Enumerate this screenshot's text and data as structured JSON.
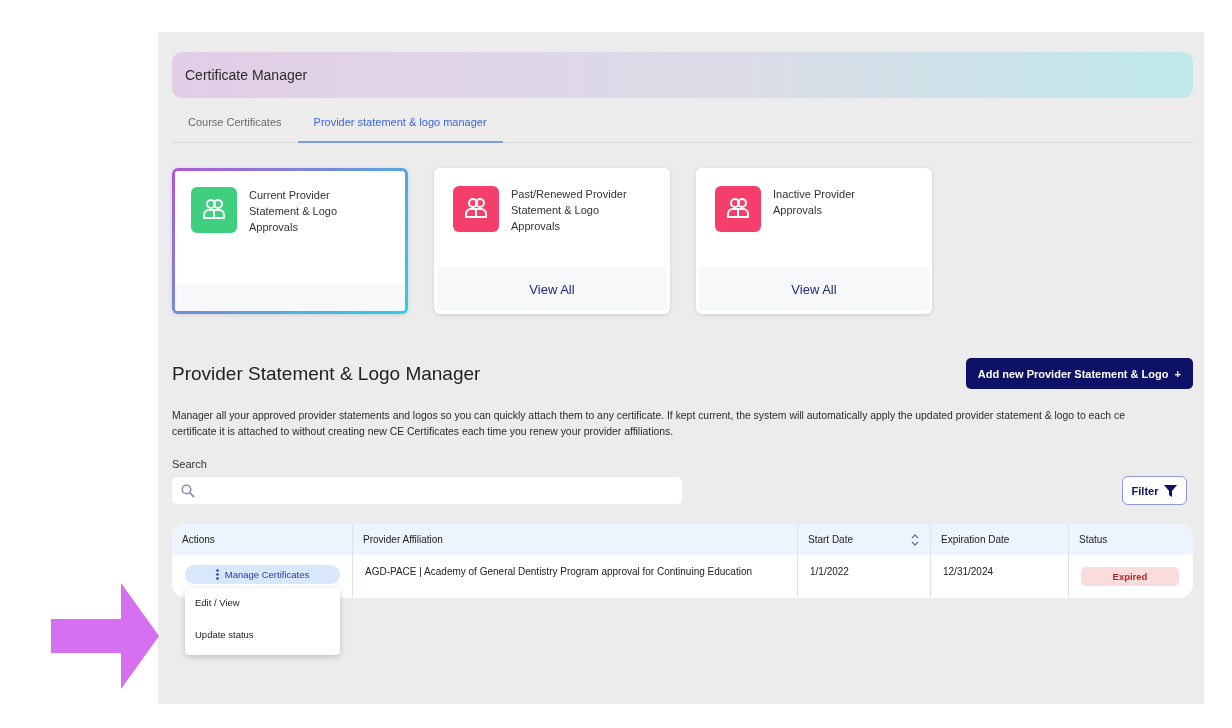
{
  "header": {
    "title": "Certificate Manager"
  },
  "tabs": [
    {
      "label": "Course Certificates",
      "selected": false
    },
    {
      "label": "Provider statement & logo manager",
      "selected": true
    }
  ],
  "cards": [
    {
      "title": "Current Provider Statement & Logo Approvals",
      "selected": true,
      "color": "#3ecf7f"
    },
    {
      "title": "Past/Renewed Provider Statement & Logo Approvals",
      "selected": false,
      "color": "#f43f6a",
      "link": "View All"
    },
    {
      "title": "Inactive Provider Approvals",
      "selected": false,
      "color": "#f43f6a",
      "link": "View All"
    }
  ],
  "section": {
    "title": "Provider Statement & Logo Manager",
    "add_button": "Add new Provider Statement & Logo",
    "add_icon": "+",
    "description": [
      "Manager all your approved provider statements and logos so you can quickly attach them to any certificate. If kept current, the system will automatically apply the updated provider statement & logo to each ce",
      "certificate it is attached to without creating new CE Certificates each time you renew your provider affiliations."
    ]
  },
  "search": {
    "label": "Search"
  },
  "filter_button": "Filter",
  "table": {
    "columns": [
      {
        "label": "Actions",
        "sortable": false
      },
      {
        "label": "Provider Affiliation",
        "sortable": false
      },
      {
        "label": "Start Date",
        "sortable": true
      },
      {
        "label": "Expiration Date",
        "sortable": false
      },
      {
        "label": "Status",
        "sortable": false
      }
    ],
    "rows": [
      {
        "action": "Manage Certificates",
        "provider": "AGD-PACE | Academy of General Dentistry Program approval for Continuing Education",
        "start": "1/1/2022",
        "expiration": "12/31/2024",
        "status": "Expired",
        "expanded": true
      }
    ]
  },
  "menu": {
    "items": [
      "Edit / View",
      "Update status"
    ]
  }
}
